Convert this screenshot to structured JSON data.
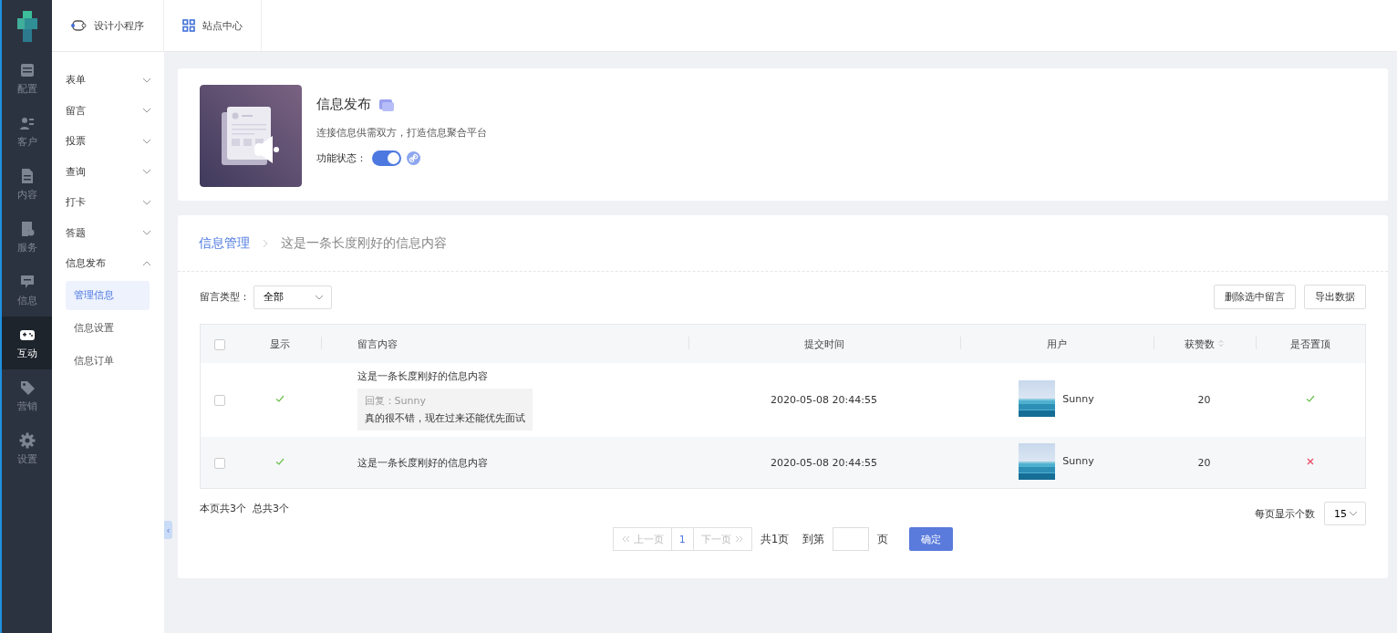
{
  "rail": {
    "items": [
      {
        "label": "配置",
        "selected": false
      },
      {
        "label": "客户",
        "selected": false
      },
      {
        "label": "内容",
        "selected": false
      },
      {
        "label": "服务",
        "selected": false
      },
      {
        "label": "信息",
        "selected": false
      },
      {
        "label": "互动",
        "selected": true
      },
      {
        "label": "营销",
        "selected": false
      },
      {
        "label": "设置",
        "selected": false
      }
    ]
  },
  "top_tabs": [
    {
      "label": "设计小程序"
    },
    {
      "label": "站点中心"
    }
  ],
  "menu": [
    {
      "label": "表单",
      "expanded": false
    },
    {
      "label": "留言",
      "expanded": false
    },
    {
      "label": "投票",
      "expanded": false
    },
    {
      "label": "查询",
      "expanded": false
    },
    {
      "label": "打卡",
      "expanded": false
    },
    {
      "label": "答题",
      "expanded": false
    },
    {
      "label": "信息发布",
      "expanded": true,
      "children": [
        {
          "label": "管理信息",
          "selected": true
        },
        {
          "label": "信息设置",
          "selected": false
        },
        {
          "label": "信息订单",
          "selected": false
        }
      ]
    }
  ],
  "collapse_handle": "‹",
  "feature": {
    "title": "信息发布",
    "description": "连接信息供需双方，打造信息聚合平台",
    "status_label": "功能状态：",
    "on": true
  },
  "breadcrumb": [
    {
      "label": "信息管理",
      "selected": true
    },
    {
      "label": "这是一条长度刚好的信息内容",
      "selected": false
    }
  ],
  "filter": {
    "label": "留言类型：",
    "value": "全部"
  },
  "actions": [
    "删除选中留言",
    "导出数据"
  ],
  "table": {
    "all_checked": false,
    "columns": [
      "显示",
      "留言内容",
      "提交时间",
      "用户",
      "获赞数",
      "是否置顶"
    ],
    "rows": [
      {
        "checked": false,
        "shown": true,
        "content": "这是一条长度刚好的信息内容",
        "reply_label": "回复：Sunny",
        "reply_text": "真的很不错，现在过来还能优先面试",
        "time": "2020-05-08 20:44:55",
        "user": "Sunny",
        "likes": "20",
        "pinned": true
      },
      {
        "checked": false,
        "shown": true,
        "content": "这是一条长度刚好的信息内容",
        "time": "2020-05-08 20:44:55",
        "user": "Sunny",
        "likes": "20",
        "pinned": false
      }
    ]
  },
  "summary": "本页共3个  总共3个",
  "per_page": {
    "label": "每页显示个数",
    "value": "15"
  },
  "pagination": {
    "prev": {
      "label": "上一页",
      "disabled": true
    },
    "pages": [
      {
        "label": "1",
        "selected": true
      }
    ],
    "next": {
      "label": "下一页",
      "disabled": true
    },
    "total": "共1页",
    "goto_label": "到第",
    "goto_suffix": "页",
    "confirm": "确定"
  }
}
